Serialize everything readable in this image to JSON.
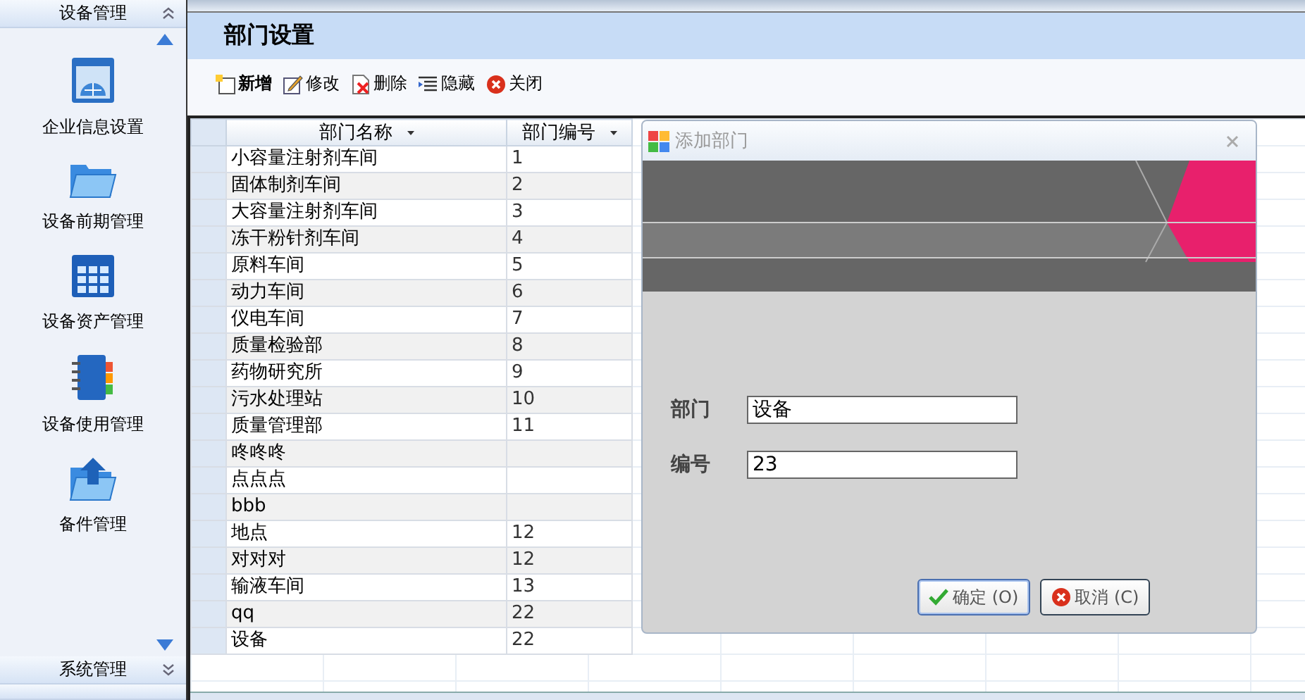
{
  "sidebar": {
    "sections": [
      {
        "title": "设备管理",
        "expanded": true,
        "items": [
          {
            "label": "企业信息设置",
            "kind": "window"
          },
          {
            "label": "设备前期管理",
            "kind": "folder"
          },
          {
            "label": "设备资产管理",
            "kind": "grid"
          },
          {
            "label": "设备使用管理",
            "kind": "binder"
          },
          {
            "label": "备件管理",
            "kind": "upload"
          }
        ]
      },
      {
        "title": "系统管理",
        "expanded": false
      }
    ]
  },
  "page_title": "部门设置",
  "toolbar": [
    {
      "label": "新增",
      "kind": "new",
      "emphasized": true
    },
    {
      "label": "修改",
      "kind": "edit",
      "emphasized": false
    },
    {
      "label": "删除",
      "kind": "delete",
      "emphasized": false
    },
    {
      "label": "隐藏",
      "kind": "hide",
      "emphasized": false
    },
    {
      "label": "关闭",
      "kind": "close",
      "emphasized": false
    }
  ],
  "table": {
    "columns": [
      "部门名称",
      "部门编号"
    ],
    "rows": [
      [
        "小容量注射剂车间",
        "1"
      ],
      [
        "固体制剂车间",
        "2"
      ],
      [
        "大容量注射剂车间",
        "3"
      ],
      [
        "冻干粉针剂车间",
        "4"
      ],
      [
        "原料车间",
        "5"
      ],
      [
        "动力车间",
        "6"
      ],
      [
        "仪电车间",
        "7"
      ],
      [
        "质量检验部",
        "8"
      ],
      [
        "药物研究所",
        "9"
      ],
      [
        "污水处理站",
        "10"
      ],
      [
        "质量管理部",
        "11"
      ],
      [
        "咚咚咚",
        ""
      ],
      [
        "点点点",
        ""
      ],
      [
        "bbb",
        ""
      ],
      [
        "地点",
        "12"
      ],
      [
        "对对对",
        "12"
      ],
      [
        "输液车间",
        "13"
      ],
      [
        "qq",
        "22"
      ],
      [
        "设备",
        "22"
      ]
    ]
  },
  "dialog": {
    "title": "添加部门",
    "fields": [
      {
        "label": "部门",
        "value": "设备"
      },
      {
        "label": "编号",
        "value": "23"
      }
    ],
    "buttons": [
      {
        "label": "确定 (O)",
        "kind": "ok"
      },
      {
        "label": "取消 (C)",
        "kind": "cancel"
      }
    ]
  }
}
